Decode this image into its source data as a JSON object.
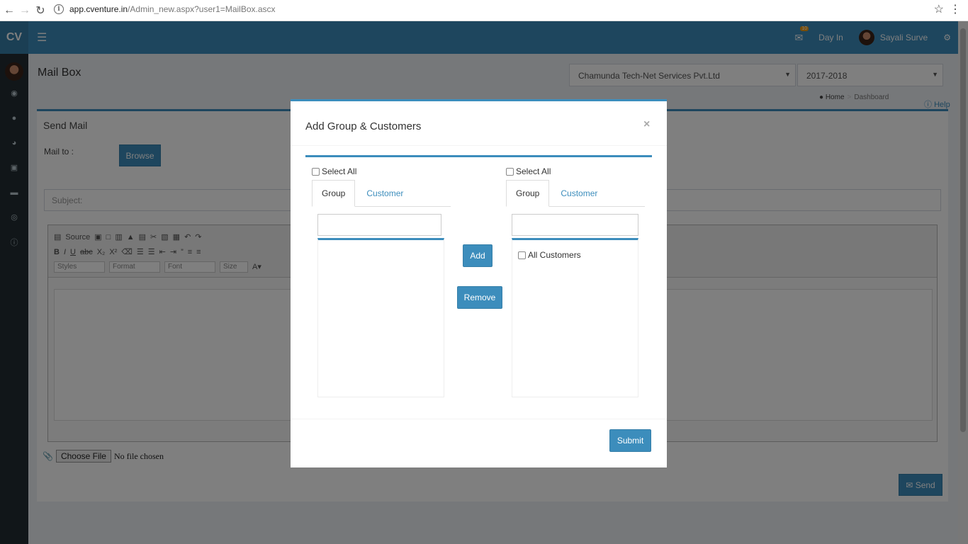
{
  "browser": {
    "url_host": "app.cventure.in",
    "url_path": "/Admin_new.aspx?user1=MailBox.ascx"
  },
  "topbar": {
    "logo": "CV",
    "notif_count": "10",
    "day_in": "Day In",
    "user_name": "Sayali Surve"
  },
  "page": {
    "title": "Mail Box",
    "company_select": "Chamunda Tech-Net Services Pvt.Ltd",
    "year_select": "2017-2018",
    "breadcrumb_home": "Home",
    "breadcrumb_current": "Dashboard",
    "help": "Help"
  },
  "mail": {
    "title": "Send Mail",
    "mail_to_label": "Mail to :",
    "browse_button": "Browse",
    "subject_placeholder": "Subject:",
    "editor": {
      "source_label": "Source",
      "styles": "Styles",
      "format": "Format",
      "font": "Font",
      "size": "Size"
    },
    "choose_file": "Choose File",
    "no_file": "No file chosen",
    "send_button": "Send"
  },
  "modal": {
    "title": "Add Group & Customers",
    "close": "×",
    "left": {
      "select_all": "Select All",
      "tab_group": "Group",
      "tab_customer": "Customer"
    },
    "right": {
      "select_all": "Select All",
      "tab_group": "Group",
      "tab_customer": "Customer",
      "items": [
        "All Customers"
      ]
    },
    "add_button": "Add",
    "remove_button": "Remove",
    "submit_button": "Submit"
  },
  "colors": {
    "primary": "#3c8dbc",
    "sidebar": "#222d32"
  }
}
